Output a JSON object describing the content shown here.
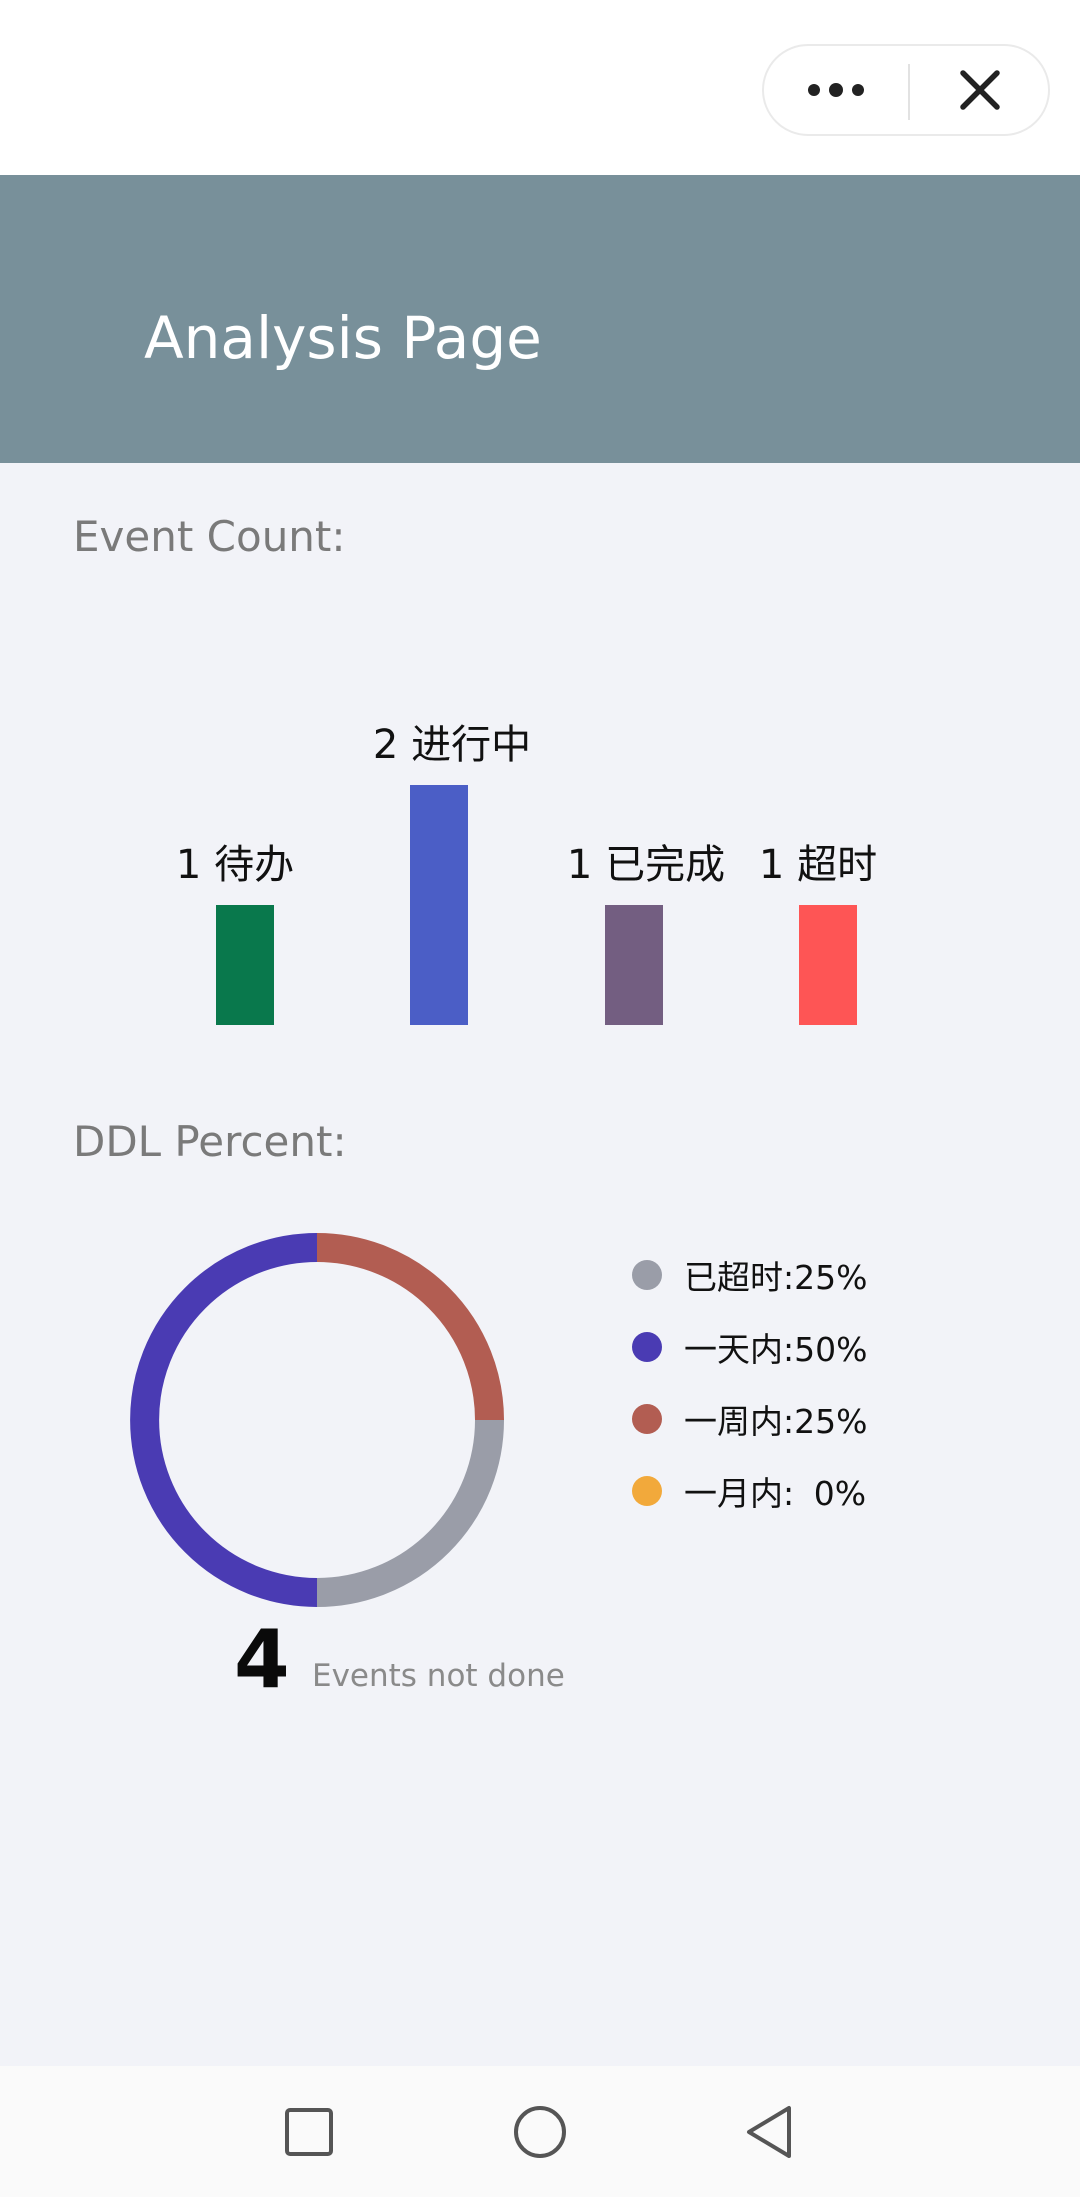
{
  "header": {
    "title": "Analysis Page"
  },
  "capsule": {
    "menu_icon": "more-dots-icon",
    "close_icon": "close-x-icon"
  },
  "event_count": {
    "label": "Event Count:"
  },
  "ddl_percent": {
    "label": "DDL Percent:",
    "total_count": "4",
    "total_caption": "Events not done",
    "legend": [
      {
        "label": "已超时:",
        "value": "25%",
        "color": "#9A9DA8"
      },
      {
        "label": "一天内:",
        "value": "50%",
        "color": "#4A3BB3"
      },
      {
        "label": "一周内:",
        "value": "25%",
        "color": "#B25D52"
      },
      {
        "label": "一月内:",
        "value": "0%",
        "color": "#F2A93B"
      }
    ]
  },
  "chart_data": [
    {
      "type": "bar",
      "categories": [
        "待办",
        "进行中",
        "已完成",
        "超时"
      ],
      "values": [
        1,
        2,
        1,
        1
      ],
      "colors": [
        "#09784C",
        "#4B5EC6",
        "#735E81",
        "#FE5555"
      ],
      "ylim": [
        0,
        2
      ],
      "data_labels": [
        "1 待办",
        "2 进行中",
        "1 已完成",
        "1 超时"
      ],
      "xlabel": "",
      "ylabel": ""
    },
    {
      "type": "pie",
      "style": "donut",
      "start": "top",
      "direction": "clockwise",
      "slices": [
        {
          "label": "一周内",
          "value": 25,
          "color": "#B25D52"
        },
        {
          "label": "已超时",
          "value": 25,
          "color": "#9A9DA8"
        },
        {
          "label": "一天内",
          "value": 50,
          "color": "#4A3BB3"
        },
        {
          "label": "一月内",
          "value": 0,
          "color": "#F2A93B"
        }
      ]
    }
  ],
  "nav": {
    "recents_icon": "square-recents-icon",
    "home_icon": "circle-home-icon",
    "back_icon": "triangle-back-icon"
  }
}
